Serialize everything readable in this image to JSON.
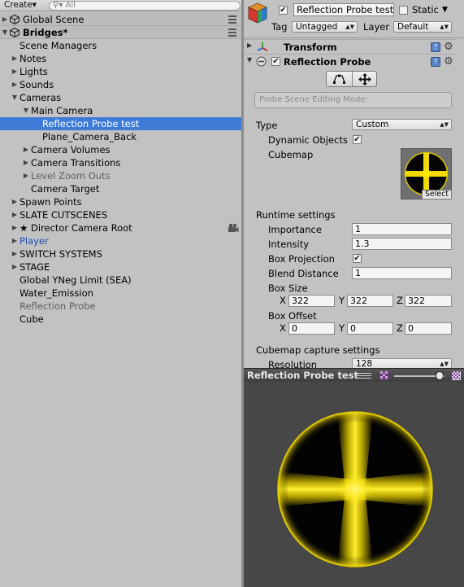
{
  "hierarchy": {
    "create_label": "Create",
    "search_placeholder": "All",
    "rows": [
      {
        "label": "Global Scene",
        "indent": 0,
        "kind": "scene",
        "expanded": false
      },
      {
        "label": "Bridges*",
        "indent": 0,
        "kind": "scene",
        "expanded": true
      },
      {
        "label": "Scene Managers",
        "indent": 1
      },
      {
        "label": "Notes",
        "indent": 1,
        "arrow": "right"
      },
      {
        "label": "Lights",
        "indent": 1,
        "arrow": "right"
      },
      {
        "label": "Sounds",
        "indent": 1,
        "arrow": "right"
      },
      {
        "label": "Cameras",
        "indent": 1,
        "arrow": "down"
      },
      {
        "label": "Main Camera",
        "indent": 2,
        "arrow": "down"
      },
      {
        "label": "Reflection Probe test",
        "indent": 3,
        "selected": true
      },
      {
        "label": "Plane_Camera_Back",
        "indent": 3
      },
      {
        "label": "Camera Volumes",
        "indent": 2,
        "arrow": "right"
      },
      {
        "label": "Camera Transitions",
        "indent": 2,
        "arrow": "right"
      },
      {
        "label": "Level Zoom Outs",
        "indent": 2,
        "arrow": "right",
        "style": "grey"
      },
      {
        "label": "Camera Target",
        "indent": 2
      },
      {
        "label": "Spawn Points",
        "indent": 1,
        "arrow": "right"
      },
      {
        "label": "SLATE CUTSCENES",
        "indent": 1,
        "arrow": "right"
      },
      {
        "label": "★ Director Camera Root",
        "indent": 1,
        "arrow": "right",
        "camera_icon": true
      },
      {
        "label": "Player",
        "indent": 1,
        "arrow": "right",
        "style": "blue"
      },
      {
        "label": "SWITCH SYSTEMS",
        "indent": 1,
        "arrow": "right"
      },
      {
        "label": "STAGE",
        "indent": 1,
        "arrow": "right"
      },
      {
        "label": "Global YNeg Limit (SEA)",
        "indent": 1
      },
      {
        "label": "Water_Emission",
        "indent": 1
      },
      {
        "label": "Reflection Probe",
        "indent": 1,
        "style": "grey"
      },
      {
        "label": "Cube",
        "indent": 1
      }
    ]
  },
  "inspector": {
    "object_name": "Reflection Probe test",
    "active": true,
    "static_label": "Static",
    "static_checked": false,
    "tag_label": "Tag",
    "tag_value": "Untagged",
    "layer_label": "Layer",
    "layer_value": "Default",
    "transform_title": "Transform",
    "probe_title": "Reflection Probe",
    "probe_enabled": true,
    "scene_editing_mode": "Probe Scene Editing Mode:",
    "type_label": "Type",
    "type_value": "Custom",
    "dynamic_objects_label": "Dynamic Objects",
    "dynamic_objects_checked": true,
    "cubemap_label": "Cubemap",
    "select_label": "Select",
    "runtime_header": "Runtime settings",
    "importance_label": "Importance",
    "importance_value": "1",
    "intensity_label": "Intensity",
    "intensity_value": "1.3",
    "box_projection_label": "Box Projection",
    "box_projection_checked": true,
    "blend_distance_label": "Blend Distance",
    "blend_distance_value": "1",
    "box_size_label": "Box Size",
    "box_size": {
      "x": "322",
      "y": "322",
      "z": "322"
    },
    "box_offset_label": "Box Offset",
    "box_offset": {
      "x": "0",
      "y": "0",
      "z": "0"
    },
    "axis_x": "X",
    "axis_y": "Y",
    "axis_z": "Z",
    "capture_header": "Cubemap capture settings",
    "resolution_label": "Resolution",
    "resolution_value": "128"
  },
  "preview": {
    "title": "Reflection Probe test",
    "exposure": 0.9
  },
  "colors": {
    "selection": "#3d7bd6",
    "cubemap_yellow": "#ffe600",
    "preview_bg": "#474747"
  }
}
